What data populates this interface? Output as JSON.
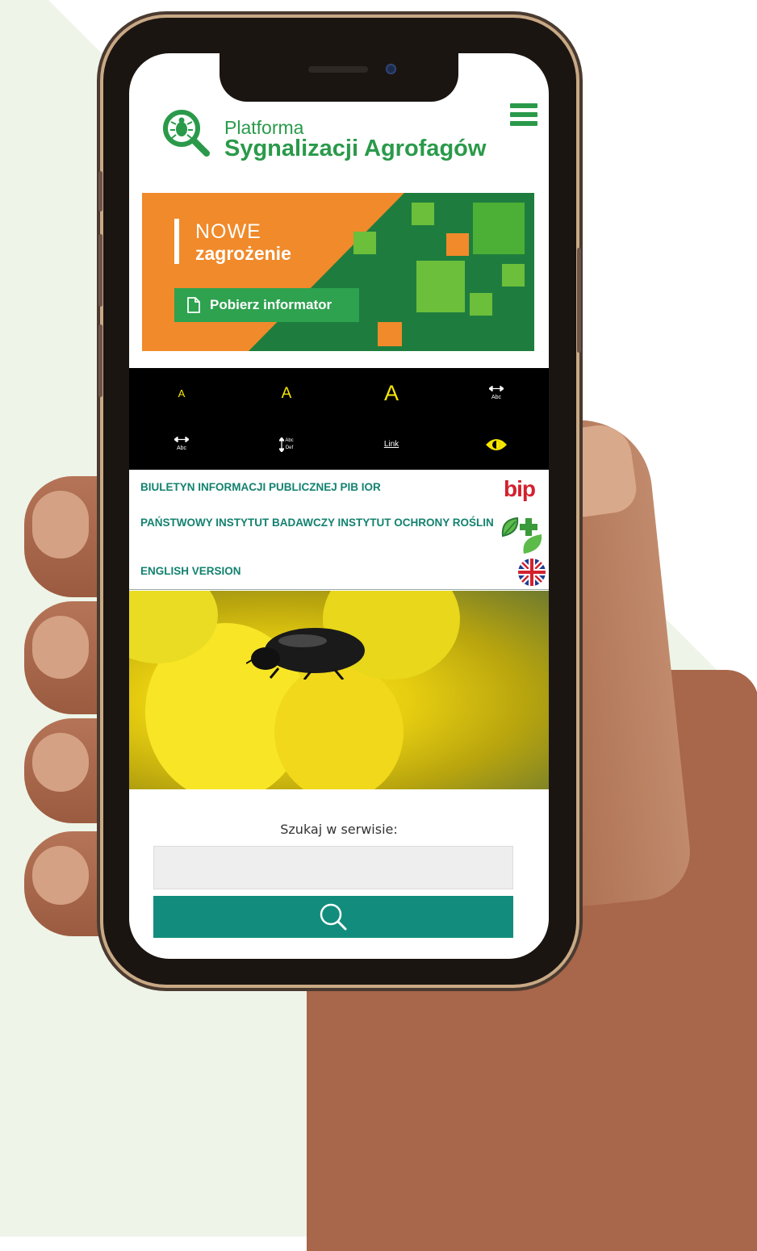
{
  "header": {
    "title_line1": "Platforma",
    "title_line2": "Sygnalizacji Agrofagów"
  },
  "banner": {
    "line1": "NOWE",
    "line2": "zagrożenie",
    "button_label": "Pobierz informator"
  },
  "accessibility": {
    "font_small": "A",
    "font_medium": "A",
    "font_large": "A",
    "letter_spacing_label": "Abc",
    "word_spacing_label": "Abc",
    "line_height_label": "Abc\nDef",
    "links_label": "Link"
  },
  "links": [
    {
      "label": "BIULETYN INFORMACJI PUBLICZNEJ PIB IOR",
      "badge": "bip"
    },
    {
      "label": "PAŃSTWOWY INSTYTUT BADAWCZY INSTYTUT OCHRONY ROŚLIN",
      "badge_icon": "leaf-cross-icon"
    },
    {
      "label": "ENGLISH VERSION",
      "badge_icon": "uk-flag-icon"
    }
  ],
  "search": {
    "label": "Szukaj w serwisie:",
    "value": "",
    "placeholder": ""
  },
  "colors": {
    "brand_green": "#2a9a4a",
    "banner_orange": "#f08a2a",
    "banner_dark_green": "#1e7d3e",
    "link_teal": "#13826f",
    "search_button": "#128d7d",
    "toolbar_yellow": "#f5e600",
    "bip_red": "#d3212d"
  }
}
